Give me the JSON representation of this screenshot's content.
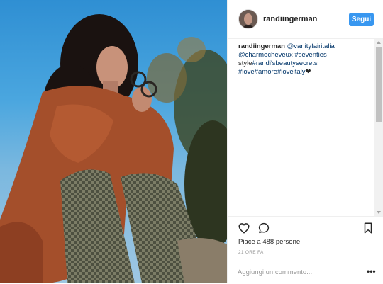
{
  "post": {
    "username": "randiingerman",
    "follow_label": "Segui",
    "caption": {
      "username": "randiingerman",
      "segments": [
        {
          "text": "@vanityfairitalia",
          "link": true
        },
        {
          "text": " ",
          "link": false
        },
        {
          "text": "@charmecheveux",
          "link": true
        },
        {
          "text": " ",
          "link": false
        },
        {
          "text": "#seventies",
          "link": true
        },
        {
          "text": " style",
          "link": false
        },
        {
          "text": "#randi'sbeautysecrets",
          "link": true
        },
        {
          "text": " ",
          "link": false
        },
        {
          "text": "#love",
          "link": true
        },
        {
          "text": "#amore",
          "link": true
        },
        {
          "text": "#loveitaly",
          "link": true
        },
        {
          "text": "❤",
          "link": false
        }
      ]
    },
    "likes_text": "Piace a 488 persone",
    "time_text": "21 ORE FA",
    "comment_placeholder": "Aggiungi un commento...",
    "more_label": "•••"
  },
  "colors": {
    "accent": "#3897f0",
    "link": "#003569",
    "text": "#262626",
    "muted": "#999999"
  },
  "icons": {
    "like": "heart-outline-icon",
    "comment": "speech-bubble-icon",
    "save": "bookmark-icon",
    "more": "ellipsis-icon"
  }
}
